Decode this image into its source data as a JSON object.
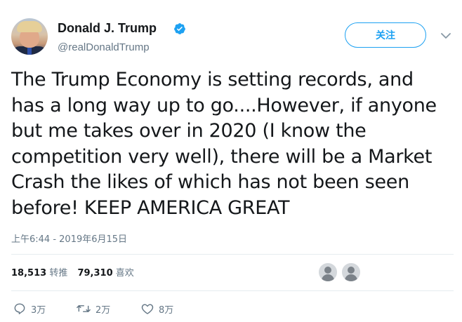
{
  "author": {
    "display_name": "Donald J. Trump",
    "handle": "@realDonaldTrump",
    "verified": true
  },
  "follow_button": {
    "label": "关注"
  },
  "tweet": {
    "lines": [
      "The Trump Economy is setting records, and",
      "has a long way up to go....However, if anyone",
      "but me takes over in 2020 (I know the",
      "competition very well), there will be a Market",
      "Crash the likes of which has not been seen",
      "before! KEEP AMERICA GREAT"
    ],
    "timestamp": "上午6:44 - 2019年6月15日"
  },
  "stats": {
    "retweets_count": "18,513",
    "retweets_label": "转推",
    "likes_count": "79,310",
    "likes_label": "喜欢"
  },
  "actions": {
    "reply_count": "3万",
    "retweet_count": "2万",
    "like_count": "8万"
  },
  "icons": {
    "verified": "verified-badge-icon",
    "caret": "chevron-down-icon",
    "reply": "reply-icon",
    "retweet": "retweet-icon",
    "like": "heart-icon"
  },
  "colors": {
    "accent": "#1da1f2",
    "text": "#14171a",
    "secondary": "#657786",
    "divider": "#e6ecf0"
  }
}
